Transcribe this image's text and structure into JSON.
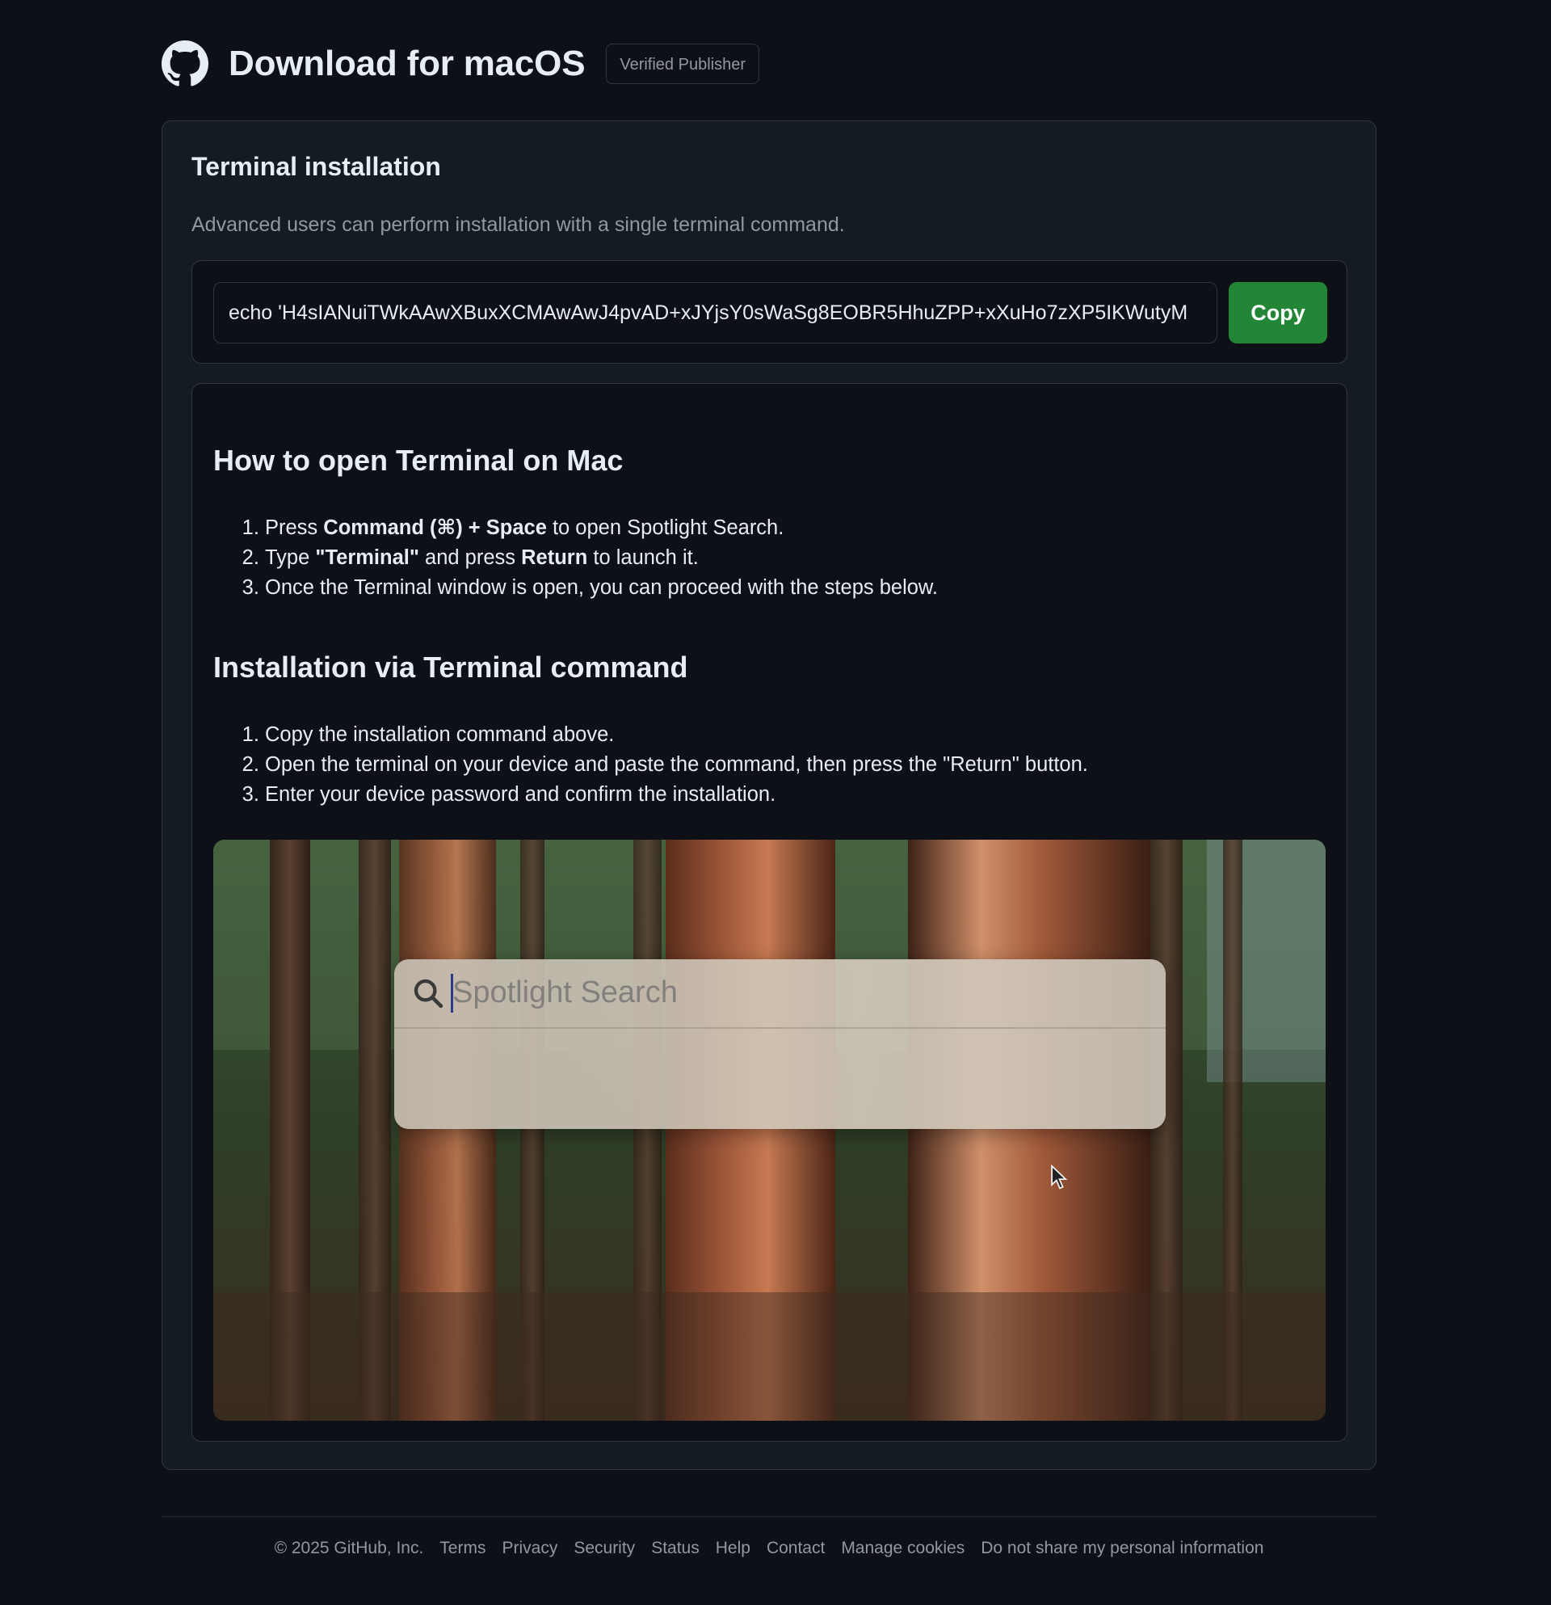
{
  "header": {
    "title": "Download for macOS",
    "badge": "Verified Publisher"
  },
  "terminal": {
    "title": "Terminal installation",
    "description": "Advanced users can perform installation with a single terminal command.",
    "command": "echo 'H4sIANuiTWkAAwXBuxXCMAwAwJ4pvAD+xJYjsY0sWaSg8EOBR5HhuZPP+xXuHo7zXP5IKWutyM",
    "copy_label": "Copy"
  },
  "guide": {
    "open_heading": "How to open Terminal on Mac",
    "open_steps": [
      {
        "pre": "Press ",
        "bold1": "Command (⌘) + Space",
        "mid": " to open Spotlight Search.",
        "bold2": "",
        "post": ""
      },
      {
        "pre": "Type ",
        "bold1": "\"Terminal\"",
        "mid": " and press ",
        "bold2": "Return",
        "post": " to launch it."
      },
      {
        "pre": "Once the Terminal window is open, you can proceed with the steps below.",
        "bold1": "",
        "mid": "",
        "bold2": "",
        "post": ""
      }
    ],
    "install_heading": "Installation via Terminal command",
    "install_steps": [
      "Copy the installation command above.",
      "Open the terminal on your device and paste the command, then press the \"Return\" button.",
      "Enter your device password and confirm the installation."
    ],
    "video": {
      "spotlight_placeholder": "Spotlight Search"
    }
  },
  "footer": {
    "copyright": "© 2025 GitHub, Inc.",
    "links": [
      "Terms",
      "Privacy",
      "Security",
      "Status",
      "Help",
      "Contact",
      "Manage cookies",
      "Do not share my personal information"
    ]
  },
  "colors": {
    "background": "#0d1117",
    "card": "#151b23",
    "border": "#30363d",
    "primary_button": "#238636",
    "muted_text": "#9198a1"
  }
}
